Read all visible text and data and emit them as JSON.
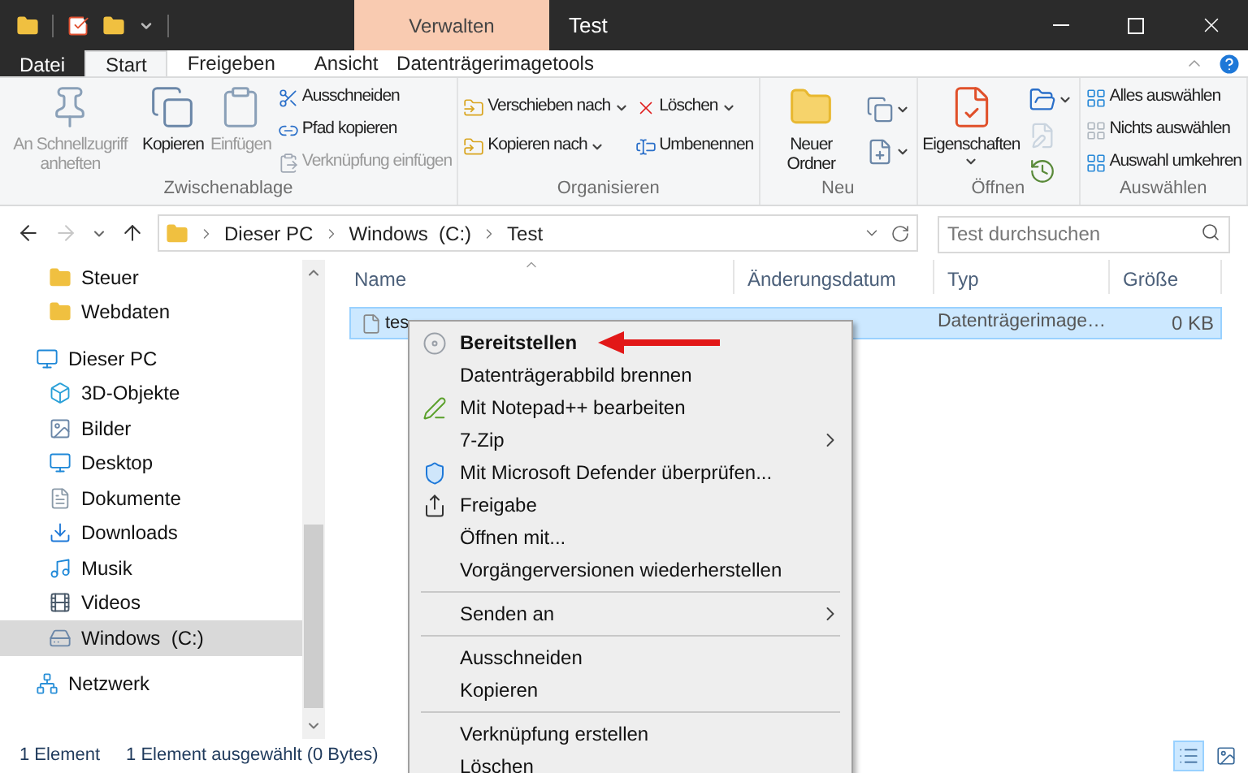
{
  "window": {
    "title": "Test",
    "contextual_tab_group": "Verwalten"
  },
  "ribbon_tabs": [
    {
      "label": "Datei",
      "kind": "file",
      "selected": false
    },
    {
      "label": "Start",
      "kind": "tab",
      "selected": true
    },
    {
      "label": "Freigeben",
      "kind": "tab",
      "selected": false
    },
    {
      "label": "Ansicht",
      "kind": "tab",
      "selected": false
    },
    {
      "label": "Datenträgerimagetools",
      "kind": "contextual",
      "selected": false
    }
  ],
  "ribbon_groups": [
    {
      "label": "Zwischenablage",
      "buttons": [
        {
          "kind": "large",
          "label": "An Schnellzugriff anheften",
          "disabled": true,
          "dropdown": false
        },
        {
          "kind": "large",
          "label": "Kopieren",
          "disabled": false,
          "dropdown": false
        },
        {
          "kind": "large",
          "label": "Einfügen",
          "disabled": true,
          "dropdown": false
        },
        {
          "kind": "small",
          "label": "Ausschneiden",
          "disabled": false,
          "dropdown": false
        },
        {
          "kind": "small",
          "label": "Pfad kopieren",
          "disabled": false,
          "dropdown": false
        },
        {
          "kind": "small",
          "label": "Verknüpfung einfügen",
          "disabled": true,
          "dropdown": false
        }
      ]
    },
    {
      "label": "Organisieren",
      "buttons": [
        {
          "kind": "small",
          "label": "Verschieben nach",
          "disabled": false,
          "dropdown": true
        },
        {
          "kind": "small",
          "label": "Kopieren nach",
          "disabled": false,
          "dropdown": true
        },
        {
          "kind": "small",
          "label": "Löschen",
          "disabled": false,
          "dropdown": true
        },
        {
          "kind": "small",
          "label": "Umbenennen",
          "disabled": false,
          "dropdown": false
        }
      ]
    },
    {
      "label": "Neu",
      "buttons": [
        {
          "kind": "large",
          "label": "Neuer Ordner",
          "disabled": false,
          "dropdown": false
        },
        {
          "kind": "icon",
          "disabled": false,
          "dropdown": true
        },
        {
          "kind": "icon",
          "disabled": false,
          "dropdown": true
        }
      ]
    },
    {
      "label": "Öffnen",
      "buttons": [
        {
          "kind": "large",
          "label": "Eigenschaften",
          "disabled": false,
          "dropdown": true
        },
        {
          "kind": "icon",
          "disabled": false,
          "dropdown": true
        },
        {
          "kind": "icon",
          "disabled": true,
          "dropdown": false
        },
        {
          "kind": "icon",
          "disabled": false,
          "dropdown": false
        }
      ]
    },
    {
      "label": "Auswählen",
      "buttons": [
        {
          "kind": "small",
          "label": "Alles auswählen",
          "disabled": false,
          "dropdown": false
        },
        {
          "kind": "small",
          "label": "Nichts auswählen",
          "disabled": false,
          "dropdown": false
        },
        {
          "kind": "small",
          "label": "Auswahl umkehren",
          "disabled": false,
          "dropdown": false
        }
      ]
    }
  ],
  "address_bar": {
    "forward_disabled": true,
    "path": [
      "Dieser PC",
      "Windows  (C:)",
      "Test"
    ]
  },
  "search": {
    "placeholder": "Test durchsuchen"
  },
  "nav_pane": {
    "quick_access_children": [
      {
        "label": "Steuer",
        "selected": false
      },
      {
        "label": "Webdaten",
        "selected": false
      }
    ],
    "tree": [
      {
        "label": "Dieser PC",
        "selected": false,
        "children": [
          {
            "label": "3D-Objekte",
            "selected": false
          },
          {
            "label": "Bilder",
            "selected": false
          },
          {
            "label": "Desktop",
            "selected": false
          },
          {
            "label": "Dokumente",
            "selected": false
          },
          {
            "label": "Downloads",
            "selected": false
          },
          {
            "label": "Musik",
            "selected": false
          },
          {
            "label": "Videos",
            "selected": false
          },
          {
            "label": "Windows  (C:)",
            "selected": true
          }
        ]
      },
      {
        "label": "Netzwerk",
        "selected": false
      }
    ]
  },
  "file_list": {
    "columns": [
      "Name",
      "Änderungsdatum",
      "Typ",
      "Größe"
    ],
    "rows": [
      {
        "name": "tes",
        "type": "Datenträgerimage…",
        "size": "0 KB",
        "selected": true
      }
    ]
  },
  "context_menu": {
    "items": [
      {
        "kind": "item",
        "label": "Bereitstellen",
        "bold": true,
        "submenu": false
      },
      {
        "kind": "item",
        "label": "Datenträgerabbild brennen",
        "bold": false,
        "submenu": false
      },
      {
        "kind": "item",
        "label": "Mit Notepad++ bearbeiten",
        "bold": false,
        "submenu": false
      },
      {
        "kind": "item",
        "label": "7-Zip",
        "bold": false,
        "submenu": true
      },
      {
        "kind": "item",
        "label": "Mit Microsoft Defender überprüfen...",
        "bold": false,
        "submenu": false
      },
      {
        "kind": "item",
        "label": "Freigabe",
        "bold": false,
        "submenu": false
      },
      {
        "kind": "item",
        "label": "Öffnen mit...",
        "bold": false,
        "submenu": false
      },
      {
        "kind": "item",
        "label": "Vorgängerversionen wiederherstellen",
        "bold": false,
        "submenu": false
      },
      {
        "kind": "separator"
      },
      {
        "kind": "item",
        "label": "Senden an",
        "bold": false,
        "submenu": true
      },
      {
        "kind": "separator"
      },
      {
        "kind": "item",
        "label": "Ausschneiden",
        "bold": false,
        "submenu": false
      },
      {
        "kind": "item",
        "label": "Kopieren",
        "bold": false,
        "submenu": false
      },
      {
        "kind": "separator"
      },
      {
        "kind": "item",
        "label": "Verknüpfung erstellen",
        "bold": false,
        "submenu": false
      },
      {
        "kind": "item",
        "label": "Löschen",
        "bold": false,
        "submenu": false
      }
    ]
  },
  "status_bar": {
    "item_count": "1 Element",
    "selection": "1 Element ausgewählt (0 Bytes)",
    "view_buttons": [
      {
        "selected": true
      },
      {
        "selected": false
      }
    ]
  }
}
